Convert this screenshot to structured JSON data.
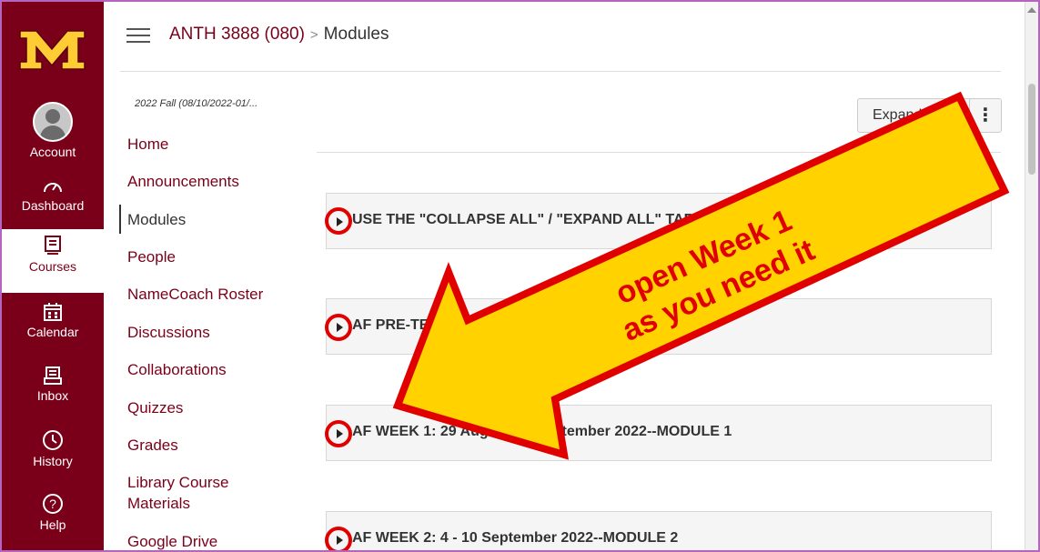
{
  "global_nav": {
    "logo_letter": "M",
    "items": [
      {
        "label": "Account"
      },
      {
        "label": "Dashboard"
      },
      {
        "label": "Courses"
      },
      {
        "label": "Calendar"
      },
      {
        "label": "Inbox"
      },
      {
        "label": "History"
      },
      {
        "label": "Help"
      }
    ]
  },
  "header": {
    "course": "ANTH 3888 (080)",
    "separator": ">",
    "page": "Modules"
  },
  "course_nav": {
    "term": "2022 Fall (08/10/2022-01/...",
    "items": [
      {
        "label": "Home"
      },
      {
        "label": "Announcements"
      },
      {
        "label": "Modules"
      },
      {
        "label": "People"
      },
      {
        "label": "NameCoach Roster"
      },
      {
        "label": "Discussions"
      },
      {
        "label": "Collaborations"
      },
      {
        "label": "Quizzes"
      },
      {
        "label": "Grades"
      },
      {
        "label": "Library Course Materials"
      },
      {
        "label": "Google Drive"
      }
    ]
  },
  "toolbar": {
    "expand_label": "Expand All",
    "kebab_label": "⋮"
  },
  "modules": [
    {
      "title": "USE THE \"COLLAPSE ALL\" / \"EXPAND ALL\" TAB ... wee..."
    },
    {
      "title": "AF PRE-TERM ... (NOT DUE, but read)"
    },
    {
      "title": "AF WEEK 1: 29 August - 3 September 2022--MODULE 1"
    },
    {
      "title": "AF WEEK 2: 4 - 10 September 2022--MODULE 2"
    }
  ],
  "annotation": {
    "line1": "open Week 1",
    "line2": "as you need it"
  },
  "colors": {
    "brand": "#7a0019",
    "gold": "#ffcc33",
    "arrow_fill": "#ffd200",
    "arrow_stroke": "#e00000"
  }
}
